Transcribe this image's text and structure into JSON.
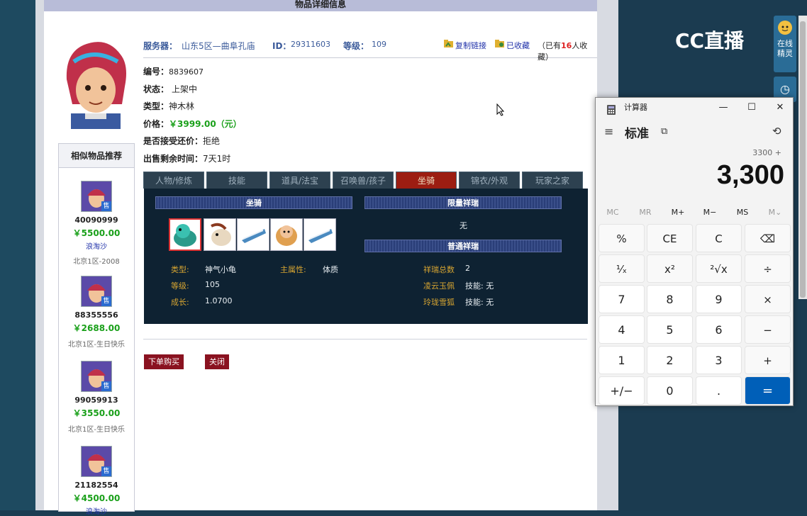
{
  "page": {
    "header_title": "物品详细信息",
    "server_label": "服务器：",
    "server_value": "山东5区—曲阜孔庙",
    "id_label": "ID：",
    "id_value": "29311603",
    "level_label": "等级：",
    "level_value": "109",
    "copy_link": "复制链接",
    "favorited": "已收藏",
    "fav_prefix": "（已有",
    "fav_count": "16",
    "fav_suffix": "人收藏）"
  },
  "info": [
    {
      "k": "编号：",
      "v": "8839607"
    },
    {
      "k": "状态：",
      "v": "上架中"
    },
    {
      "k": "类型：",
      "v": "神木林"
    },
    {
      "k": "价格：",
      "v": "￥3999.00（元）"
    },
    {
      "k": "是否接受还价：",
      "v": "拒绝"
    },
    {
      "k": "出售剩余时间：",
      "v": "7天1时"
    }
  ],
  "similar": {
    "title": "相似物品推荐",
    "items": [
      {
        "id": "40090999",
        "price": "￥5500.00",
        "seller": "浪淘沙",
        "server": "北京1区-2008",
        "tag": "售"
      },
      {
        "id": "88355556",
        "price": "￥2688.00",
        "seller": "",
        "server": "北京1区-生日快乐",
        "tag": "售"
      },
      {
        "id": "99059913",
        "price": "￥3550.00",
        "seller": "",
        "server": "北京1区-生日快乐",
        "tag": "售"
      },
      {
        "id": "21182554",
        "price": "￥4500.00",
        "seller": "浪淘沙",
        "server": "",
        "tag": "售"
      }
    ]
  },
  "tabs": [
    "人物/修炼",
    "技能",
    "道具/法宝",
    "召唤兽/孩子",
    "坐骑",
    "锦衣/外观",
    "玩家之家"
  ],
  "active_tab": 4,
  "panel": {
    "mount_band": "坐骑",
    "limit_band": "限量祥瑞",
    "limit_value": "无",
    "normal_band": "普通祥瑞",
    "attrs_left": [
      {
        "k": "类型:",
        "v": "神气小龟"
      },
      {
        "k": "等级:",
        "v": "105"
      },
      {
        "k": "成长:",
        "v": "1.0700"
      }
    ],
    "attr_main_k": "主属性:",
    "attr_main_v": "体质",
    "attrs_right": [
      {
        "k": "祥瑞总数",
        "v": "2"
      },
      {
        "k": "凌云玉佩",
        "v": "技能: 无"
      },
      {
        "k": "玲珑雪狐",
        "v": "技能: 无"
      }
    ]
  },
  "buttons": {
    "buy": "下单购买",
    "close": "关闭"
  },
  "calculator": {
    "title": "计算器",
    "mode": "标准",
    "expression": "3300 +",
    "display": "3,300",
    "memory": [
      "MC",
      "MR",
      "M+",
      "M−",
      "MS",
      "M⌄"
    ],
    "keys": [
      [
        "%",
        "CE",
        "C",
        "⌫"
      ],
      [
        "¹⁄ₓ",
        "x²",
        "²√x",
        "÷"
      ],
      [
        "7",
        "8",
        "9",
        "×"
      ],
      [
        "4",
        "5",
        "6",
        "−"
      ],
      [
        "1",
        "2",
        "3",
        "+"
      ],
      [
        "+/−",
        "0",
        ".",
        "="
      ]
    ]
  },
  "sidebar": {
    "online_label": "在线精灵",
    "logo": "CC直播"
  }
}
